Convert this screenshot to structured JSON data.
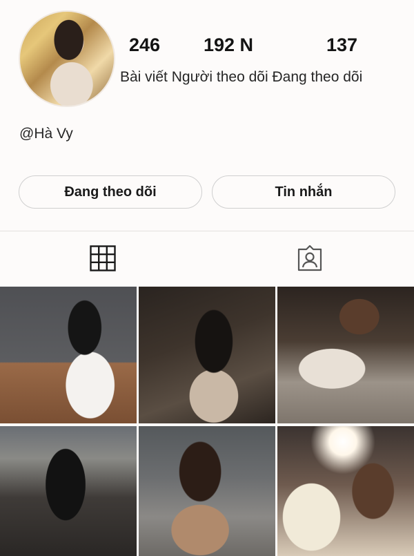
{
  "profile": {
    "stats": {
      "posts_value": "246",
      "followers_value": "192 N",
      "following_value": "137",
      "posts_label": "Bài viết",
      "followers_label": "Người theo dõi",
      "following_label": "Đang theo dõi"
    },
    "username": "@Hà Vy"
  },
  "actions": {
    "following_label": "Đang theo dõi",
    "message_label": "Tin nhắn"
  },
  "tabs": {
    "posts_icon": "grid-icon",
    "tagged_icon": "tagged-person-icon"
  },
  "colors": {
    "text": "#1a1a1a",
    "background": "#fdfbfa",
    "button_border": "#cfcfcf",
    "divider": "#e3e0dd"
  }
}
